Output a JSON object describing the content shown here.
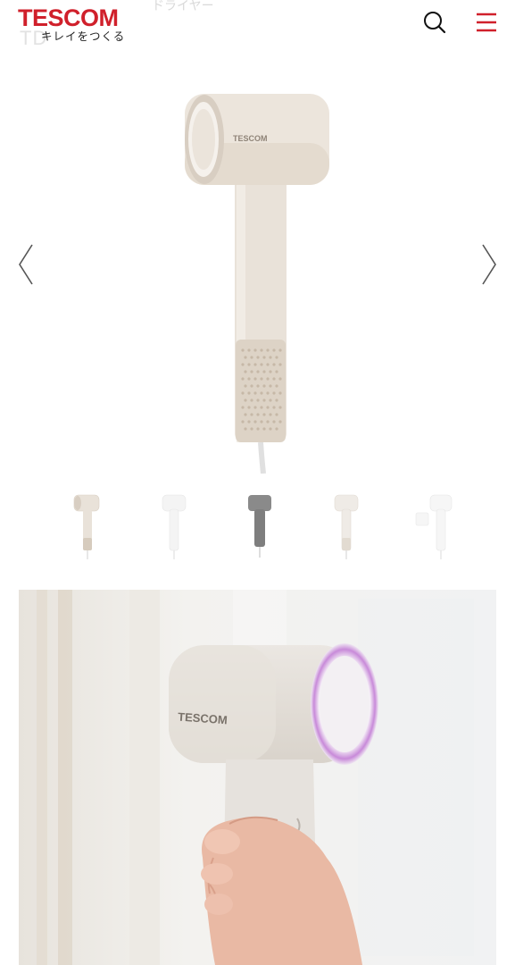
{
  "header": {
    "logo_text": "TESCOM",
    "logo_tagline": "キレイをつくる",
    "faded_title": "ドライヤー",
    "faded_code": "TD",
    "search_icon": "search-icon",
    "menu_icon": "hamburger-menu-icon"
  },
  "carousel": {
    "prev_icon": "chevron-left-icon",
    "next_icon": "chevron-right-icon",
    "product_brand": "TESCOM"
  },
  "thumbnails": [
    {
      "color": "#e9e2d9"
    },
    {
      "color": "#f4f4f4"
    },
    {
      "color": "#8a8a8a"
    },
    {
      "color": "#efebe6"
    },
    {
      "color": "#f6f6f6"
    }
  ],
  "lifestyle": {
    "brand_on_dryer": "TESCOM",
    "ring_color": "#c88ad9"
  },
  "colors": {
    "brand_red": "#d0202b",
    "product_body": "#e9e2d9"
  }
}
